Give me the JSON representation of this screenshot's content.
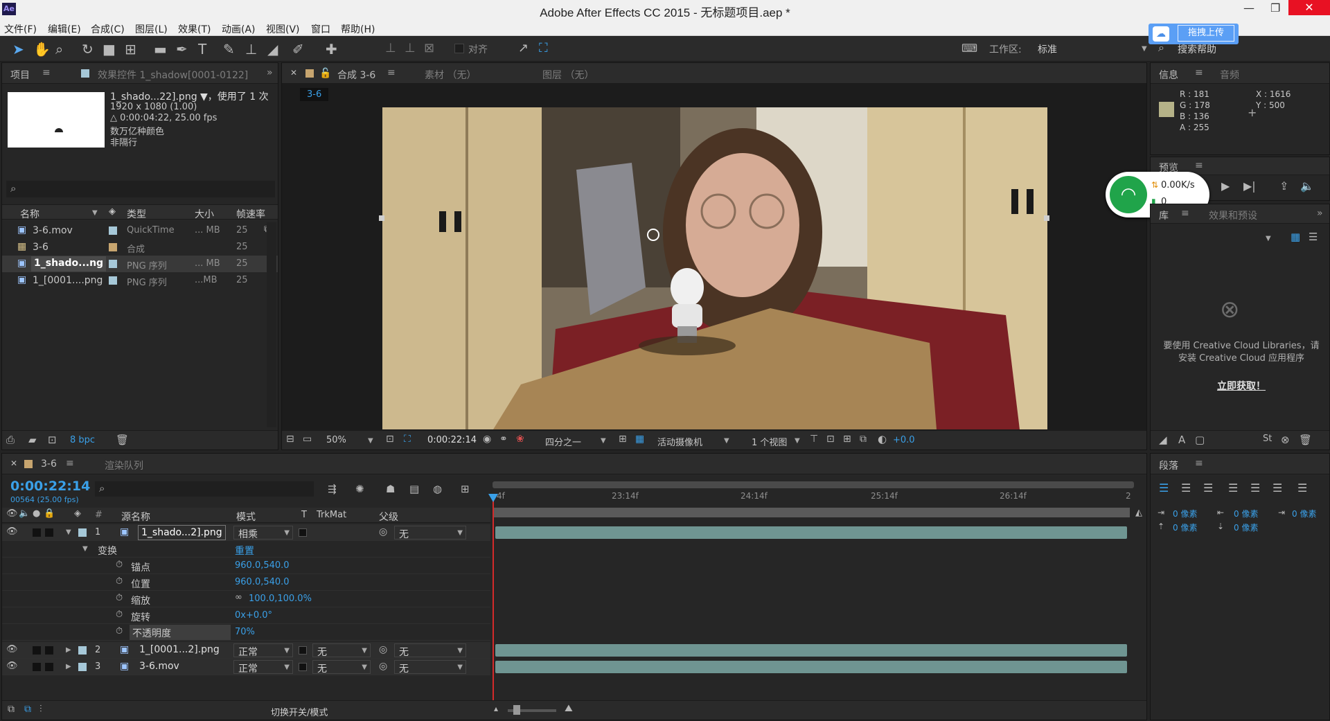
{
  "app": {
    "title": "Adobe After Effects CC 2015 - 无标题项目.aep *",
    "logo": "Ae"
  },
  "menu": [
    "文件(F)",
    "编辑(E)",
    "合成(C)",
    "图层(L)",
    "效果(T)",
    "动画(A)",
    "视图(V)",
    "窗口",
    "帮助(H)"
  ],
  "toolbar": {
    "align_label": "对齐",
    "workspace_label": "工作区:",
    "workspace_value": "标准",
    "search_help": "搜索帮助",
    "upload_label": "拖拽上传"
  },
  "project_panel": {
    "tab_project": "项目",
    "tab_effects": "效果控件 1_shadow[0001-0122]",
    "asset_name": "1_shado...22].png ▼，使用了 1 次",
    "asset_info": [
      "1920 x 1080 (1.00)",
      "△ 0:00:04:22, 25.00 fps",
      "数万亿种颜色",
      "非隔行"
    ],
    "columns": [
      "名称",
      "类型",
      "大小",
      "帧速率"
    ],
    "items": [
      {
        "name": "3-6.mov",
        "type": "QuickTime",
        "size": "... MB",
        "fps": "25",
        "color": "#a6c8d8"
      },
      {
        "name": "3-6",
        "type": "合成",
        "size": "",
        "fps": "25",
        "color": "#c7a56f"
      },
      {
        "name": "1_shado...ng",
        "type": "PNG 序列",
        "size": "... MB",
        "fps": "25",
        "color": "#a6c8d8"
      },
      {
        "name": "1_[0001....png",
        "type": "PNG 序列",
        "size": "...MB",
        "fps": "25",
        "color": "#a6c8d8"
      }
    ],
    "bpc": "8 bpc"
  },
  "comp_panel": {
    "tab_comp": "合成 3-6",
    "tab_footage": "素材 （无）",
    "tab_layer": "图层 （无）",
    "comp_label": "3-6",
    "zoom": "50%",
    "timecode": "0:00:22:14",
    "resolution": "四分之一",
    "camera": "活动摄像机",
    "views": "1 个视图",
    "exposure": "+0.0"
  },
  "info_panel": {
    "tab_info": "信息",
    "tab_audio": "音频",
    "r": "R : 181",
    "g": "G : 178",
    "b": "B : 136",
    "a": "A : 255",
    "x": "X : 1616",
    "y": "Y : 500",
    "color": "#b5b288"
  },
  "network_widget": {
    "speed": "0.00K/s",
    "count": "0"
  },
  "preview_panel": {
    "tab": "预览"
  },
  "library_panel": {
    "tab_library": "库",
    "tab_effects": "效果和预设",
    "message": "要使用 Creative Cloud Libraries，请安装 Creative Cloud 应用程序",
    "link": "立即获取！"
  },
  "timeline": {
    "tab_comp": "3-6",
    "tab_render": "渲染队列",
    "timecode": "0:00:22:14",
    "frames": "00564 (25.00 fps)",
    "ruler": [
      "4f",
      "23:14f",
      "24:14f",
      "25:14f",
      "26:14f",
      "2"
    ],
    "columns": {
      "source": "源名称",
      "mode": "模式",
      "t": "T",
      "trkmat": "TrkMat",
      "parent": "父级"
    },
    "layers": [
      {
        "num": "1",
        "name": "1_shado...2].png",
        "mode": "相乘",
        "trkmat": "",
        "parent": "无"
      },
      {
        "num": "2",
        "name": "1_[0001...2].png",
        "mode": "正常",
        "trkmat": "无",
        "parent": "无"
      },
      {
        "num": "3",
        "name": "3-6.mov",
        "mode": "正常",
        "trkmat": "无",
        "parent": "无"
      }
    ],
    "transform": {
      "label": "变换",
      "reset": "重置",
      "props": [
        {
          "name": "锚点",
          "value": "960.0,540.0"
        },
        {
          "name": "位置",
          "value": "960.0,540.0"
        },
        {
          "name": "缩放",
          "value": "100.0,100.0%"
        },
        {
          "name": "旋转",
          "value": "0x+0.0°"
        },
        {
          "name": "不透明度",
          "value": "70%"
        }
      ]
    },
    "toggle_label": "切换开关/模式"
  },
  "paragraph_panel": {
    "tab": "段落",
    "fields": [
      "0 像素",
      "0 像素",
      "0 像素",
      "0 像素",
      "0 像素"
    ]
  }
}
